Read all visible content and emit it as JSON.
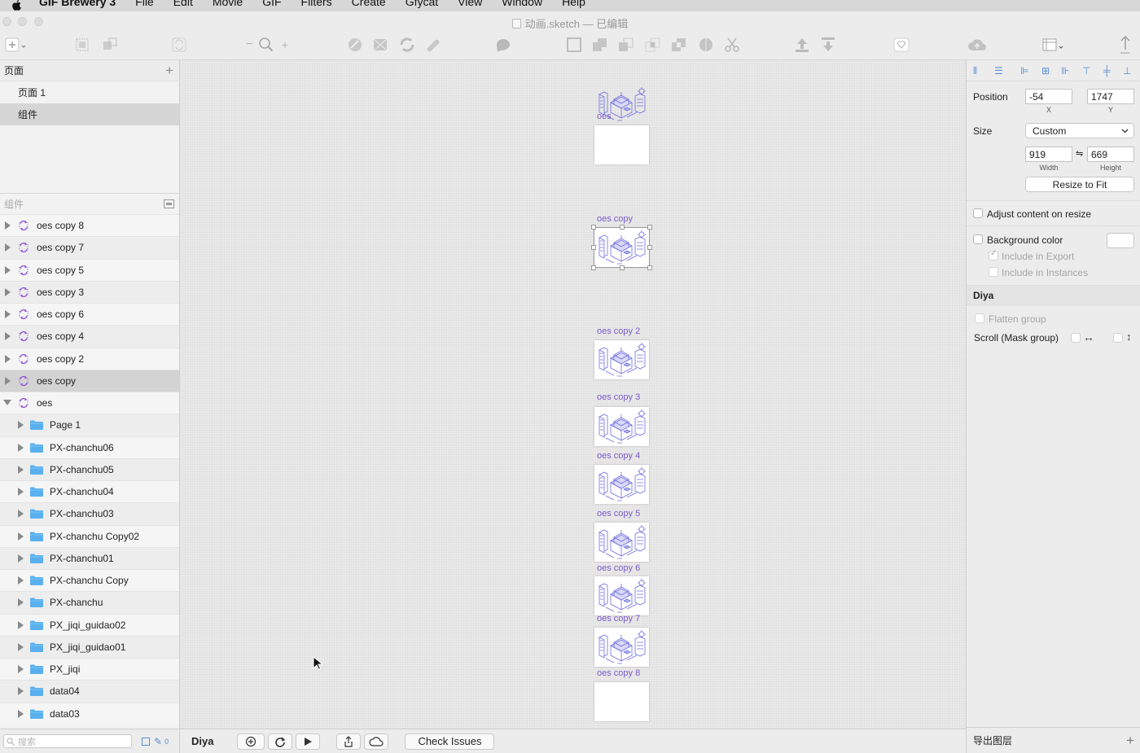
{
  "menubar": {
    "app": "GIF Brewery 3",
    "items": [
      "File",
      "Edit",
      "Movie",
      "GIF",
      "Filters",
      "Create",
      "Gfycat",
      "View",
      "Window",
      "Help"
    ]
  },
  "window": {
    "title": "动画.sketch — 已编辑"
  },
  "pages": {
    "header": "页面",
    "items": [
      {
        "label": "页面 1",
        "selected": false
      },
      {
        "label": "组件",
        "selected": true
      }
    ]
  },
  "layers": {
    "header": "组件",
    "items": [
      {
        "label": "oes copy 8",
        "type": "symbol",
        "expanded": false,
        "depth": 0,
        "selected": false
      },
      {
        "label": "oes copy 7",
        "type": "symbol",
        "expanded": false,
        "depth": 0,
        "selected": false
      },
      {
        "label": "oes copy 5",
        "type": "symbol",
        "expanded": false,
        "depth": 0,
        "selected": false
      },
      {
        "label": "oes copy 3",
        "type": "symbol",
        "expanded": false,
        "depth": 0,
        "selected": false
      },
      {
        "label": "oes copy 6",
        "type": "symbol",
        "expanded": false,
        "depth": 0,
        "selected": false
      },
      {
        "label": "oes copy 4",
        "type": "symbol",
        "expanded": false,
        "depth": 0,
        "selected": false
      },
      {
        "label": "oes copy 2",
        "type": "symbol",
        "expanded": false,
        "depth": 0,
        "selected": false
      },
      {
        "label": "oes copy",
        "type": "symbol",
        "expanded": false,
        "depth": 0,
        "selected": true
      },
      {
        "label": "oes",
        "type": "symbol",
        "expanded": true,
        "depth": 0,
        "selected": false
      },
      {
        "label": "Page 1",
        "type": "folder",
        "expanded": false,
        "depth": 1,
        "selected": false
      },
      {
        "label": "PX-chanchu06",
        "type": "folder",
        "expanded": false,
        "depth": 1,
        "selected": false
      },
      {
        "label": "PX-chanchu05",
        "type": "folder",
        "expanded": false,
        "depth": 1,
        "selected": false
      },
      {
        "label": "PX-chanchu04",
        "type": "folder",
        "expanded": false,
        "depth": 1,
        "selected": false
      },
      {
        "label": "PX-chanchu03",
        "type": "folder",
        "expanded": false,
        "depth": 1,
        "selected": false
      },
      {
        "label": "PX-chanchu Copy02",
        "type": "folder",
        "expanded": false,
        "depth": 1,
        "selected": false
      },
      {
        "label": "PX-chanchu01",
        "type": "folder",
        "expanded": false,
        "depth": 1,
        "selected": false
      },
      {
        "label": "PX-chanchu Copy",
        "type": "folder",
        "expanded": false,
        "depth": 1,
        "selected": false
      },
      {
        "label": "PX-chanchu",
        "type": "folder",
        "expanded": false,
        "depth": 1,
        "selected": false
      },
      {
        "label": "PX_jiqi_guidao02",
        "type": "folder",
        "expanded": false,
        "depth": 1,
        "selected": false
      },
      {
        "label": "PX_jiqi_guidao01",
        "type": "folder",
        "expanded": false,
        "depth": 1,
        "selected": false
      },
      {
        "label": "PX_jiqi",
        "type": "folder",
        "expanded": false,
        "depth": 1,
        "selected": false
      },
      {
        "label": "data04",
        "type": "folder",
        "expanded": false,
        "depth": 1,
        "selected": false
      },
      {
        "label": "data03",
        "type": "folder",
        "expanded": false,
        "depth": 1,
        "selected": false
      }
    ]
  },
  "search": {
    "placeholder": "搜索",
    "count": "0"
  },
  "canvas": {
    "artboards": [
      {
        "label": "oes",
        "has_image": false,
        "selected": false
      },
      {
        "label": "oes copy",
        "has_image": true,
        "selected": true
      },
      {
        "label": "oes copy 2",
        "has_image": true,
        "selected": false
      },
      {
        "label": "oes copy 3",
        "has_image": true,
        "selected": false
      },
      {
        "label": "oes copy 4",
        "has_image": true,
        "selected": false
      },
      {
        "label": "oes copy 5",
        "has_image": true,
        "selected": false
      },
      {
        "label": "oes copy 6",
        "has_image": true,
        "selected": false
      },
      {
        "label": "oes copy 7",
        "has_image": true,
        "selected": false
      },
      {
        "label": "oes copy 8",
        "has_image": false,
        "selected": false
      }
    ]
  },
  "bottombar": {
    "plugin_label": "Diya",
    "check_issues": "Check Issues"
  },
  "inspector": {
    "position_label": "Position",
    "x_value": "-54",
    "y_value": "1747",
    "x_caption": "X",
    "y_caption": "Y",
    "size_label": "Size",
    "size_preset": "Custom",
    "width_value": "919",
    "height_value": "669",
    "width_caption": "Width",
    "height_caption": "Height",
    "resize_button": "Resize to Fit",
    "adjust_content": "Adjust content on resize",
    "background_color": "Background color",
    "include_export": "Include in Export",
    "include_instances": "Include in Instances",
    "plugin_section": "Diya",
    "flatten_group": "Flatten group",
    "scroll_mask": "Scroll (Mask group)",
    "export_footer": "导出图层"
  },
  "colors": {
    "accent_purple": "#7b5cc9",
    "align_blue": "#5a8fd8",
    "selection_gray": "#d3d3d3"
  }
}
